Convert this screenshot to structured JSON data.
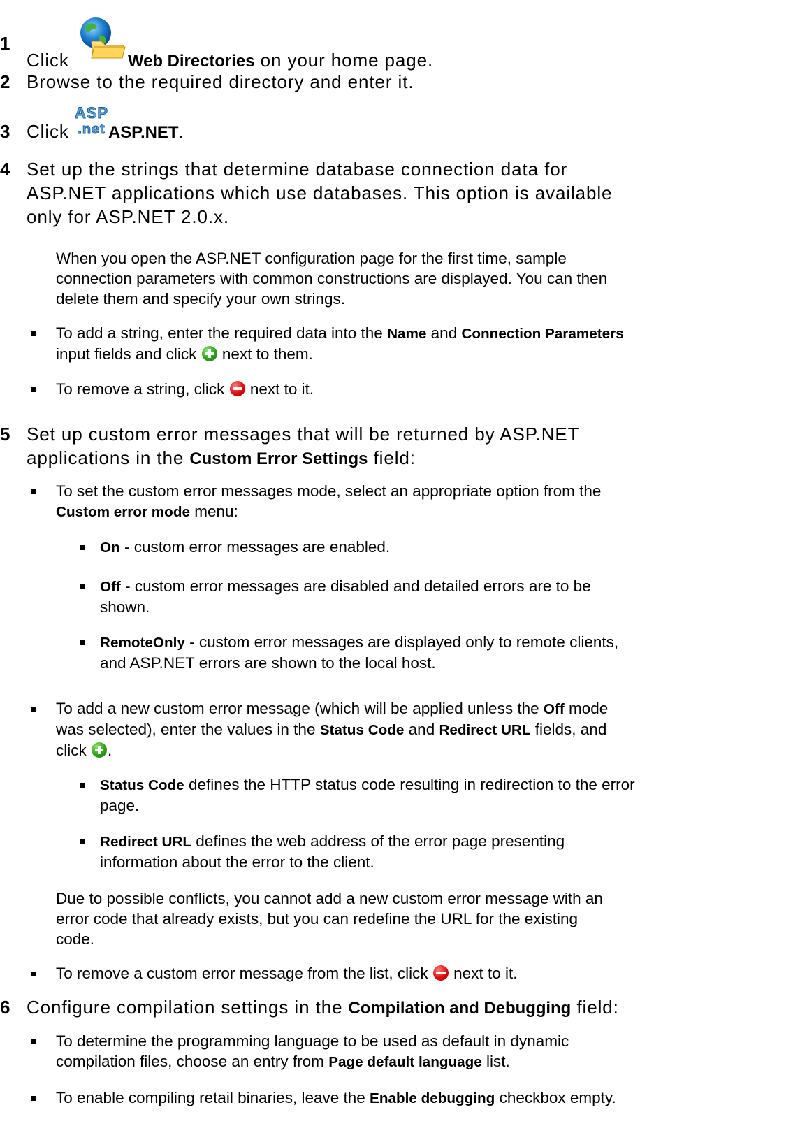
{
  "steps": [
    {
      "num": "1",
      "pre": "Click ",
      "ui": "Web Directories",
      "post": " on your home page.",
      "icon": "web-directories-icon"
    },
    {
      "num": "2",
      "text": "Browse to the required directory and enter it."
    },
    {
      "num": "3",
      "pre": "Click ",
      "ui": "ASP.NET",
      "post": ".",
      "icon": "asp-net-icon",
      "icon_text_top": "ASP",
      "icon_text_bottom": ".net"
    },
    {
      "num": "4",
      "lines": [
        "Set up the strings that determine database connection data for",
        "ASP.NET applications which use databases. This option is available",
        "only for ASP.NET 2.0.x."
      ]
    },
    {
      "num": "5",
      "line1": "Set up custom error messages that will be returned by ASP.NET",
      "line2_pre": "applications in the ",
      "line2_ui": "Custom Error Settings",
      "line2_post": " field:"
    },
    {
      "num": "6",
      "pre": "Configure compilation settings in the ",
      "ui": "Compilation and Debugging",
      "post": " field:"
    }
  ],
  "step4_note": [
    "When you open the ASP.NET configuration page for the first time, sample",
    "connection parameters with common constructions are displayed. You can then",
    "delete them and specify your own strings."
  ],
  "step4_bullets": {
    "add_pre": "To add a string, enter the required data into the ",
    "add_ui1": "Name",
    "add_mid": " and ",
    "add_ui2": "Connection Parameters",
    "add_line2_pre": "input fields and click ",
    "add_line2_post": " next to them.",
    "remove_pre": "To remove a string, click ",
    "remove_post": " next to it."
  },
  "step5_bullets": {
    "mode_line1": "To set the custom error messages mode, select an appropriate option from the",
    "mode_ui": "Custom error mode",
    "mode_line2_post": " menu:",
    "on_ui": "On",
    "on_text": " - custom error messages are enabled.",
    "off_ui": "Off",
    "off_text": " - custom error messages are disabled and detailed errors are to be",
    "off_text2": "shown.",
    "remote_ui": "RemoteOnly",
    "remote_text": " - custom error messages are displayed only to remote clients,",
    "remote_text2": "and ASP.NET errors are shown to the local host.",
    "add_line1_pre": "To add a new custom error message (which will be applied unless the ",
    "add_line1_ui": "Off",
    "add_line1_post": " mode",
    "add_line2_pre": "was selected), enter the values in the ",
    "add_line2_ui1": "Status Code",
    "add_line2_mid": " and ",
    "add_line2_ui2": "Redirect URL",
    "add_line2_post": " fields, and",
    "add_line3_pre": "click ",
    "add_line3_post": ".",
    "status_ui": "Status Code",
    "status_text": " defines the HTTP status code resulting in redirection to the error",
    "status_text2": "page.",
    "redirect_ui": "Redirect URL",
    "redirect_text": " defines the web address of the error page presenting",
    "redirect_text2": "information about the error to the client.",
    "conflict_note": [
      "Due to possible conflicts, you cannot add a new custom error message with an",
      "error code that already exists, but you can redefine the URL for the existing",
      "code."
    ],
    "remove_pre": "To remove a custom error message from the list, click ",
    "remove_post": " next to it."
  },
  "step6_bullets": {
    "lang_line1": "To determine the programming language to be used as default in dynamic",
    "lang_line2_pre": "compilation files, choose an entry from ",
    "lang_line2_ui": "Page default language",
    "lang_line2_post": " list.",
    "debug_pre": "To enable compiling retail binaries, leave the ",
    "debug_ui": "Enable debugging",
    "debug_post": " checkbox empty."
  }
}
